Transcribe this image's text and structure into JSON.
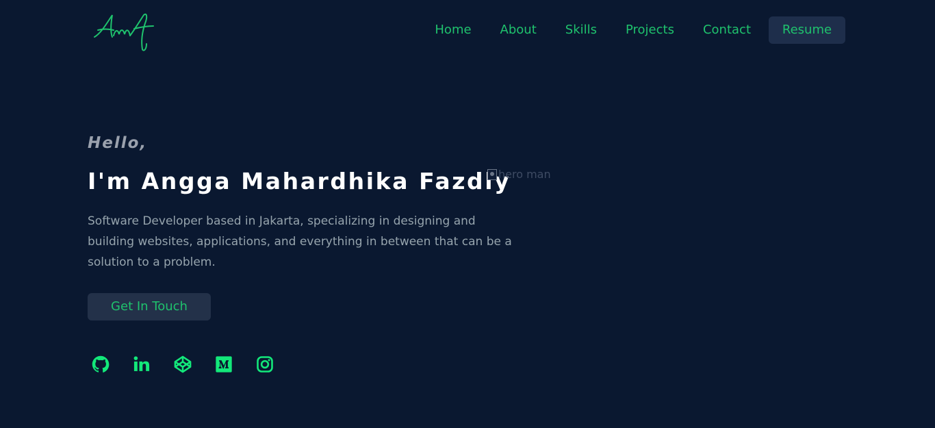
{
  "logo": {
    "text": "Amf",
    "color": "#1fc26d"
  },
  "nav": {
    "items": [
      {
        "label": "Home"
      },
      {
        "label": "About"
      },
      {
        "label": "Skills"
      },
      {
        "label": "Projects"
      },
      {
        "label": "Contact"
      }
    ],
    "resume_label": "Resume"
  },
  "hero": {
    "greeting": "Hello,",
    "name": "I'm Angga Mahardhika Fazdly",
    "image_alt": "hero man",
    "description": "Software Developer based in Jakarta, specializing in designing and building websites, applications, and everything in between that can be a solution to a problem.",
    "cta_label": "Get In Touch"
  },
  "socials": [
    {
      "icon": "github-icon"
    },
    {
      "icon": "linkedin-icon"
    },
    {
      "icon": "codepen-icon"
    },
    {
      "icon": "medium-icon"
    },
    {
      "icon": "instagram-icon"
    }
  ],
  "colors": {
    "background": "#0a1830",
    "accent": "#1fc26d",
    "icon_accent": "#13e87a",
    "button_bg": "#233149",
    "text_primary": "#ffffff",
    "text_muted": "#96a4ad"
  }
}
